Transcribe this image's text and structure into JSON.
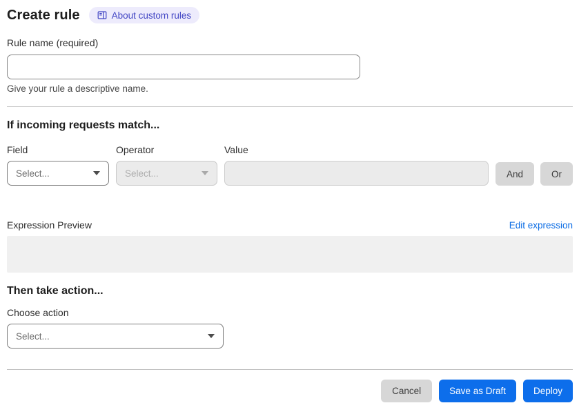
{
  "header": {
    "title": "Create rule",
    "badge": {
      "label": "About custom rules",
      "icon": "book-icon"
    }
  },
  "rule_name": {
    "label": "Rule name (required)",
    "value": "",
    "placeholder": "",
    "helper": "Give your rule a descriptive name."
  },
  "match_section": {
    "heading": "If incoming requests match...",
    "field": {
      "label": "Field",
      "selected": "Select...",
      "disabled": false
    },
    "operator": {
      "label": "Operator",
      "selected": "Select...",
      "disabled": true
    },
    "value": {
      "label": "Value",
      "value": "",
      "disabled": true
    },
    "and_label": "And",
    "or_label": "Or"
  },
  "expression": {
    "label": "Expression Preview",
    "edit_link": "Edit expression",
    "preview_content": ""
  },
  "action_section": {
    "heading": "Then take action...",
    "choose_label": "Choose action",
    "selected": "Select..."
  },
  "footer": {
    "cancel": "Cancel",
    "save_draft": "Save as Draft",
    "deploy": "Deploy"
  },
  "colors": {
    "primary_blue": "#0d6eeb",
    "link_blue": "#0b6ce4",
    "badge_bg": "#edebfc",
    "badge_text": "#4145c4",
    "disabled_bg": "#ebebeb",
    "preview_bg": "#f0f0f0",
    "gray_button_bg": "#d7d7d7",
    "divider": "#c9c9c9"
  }
}
